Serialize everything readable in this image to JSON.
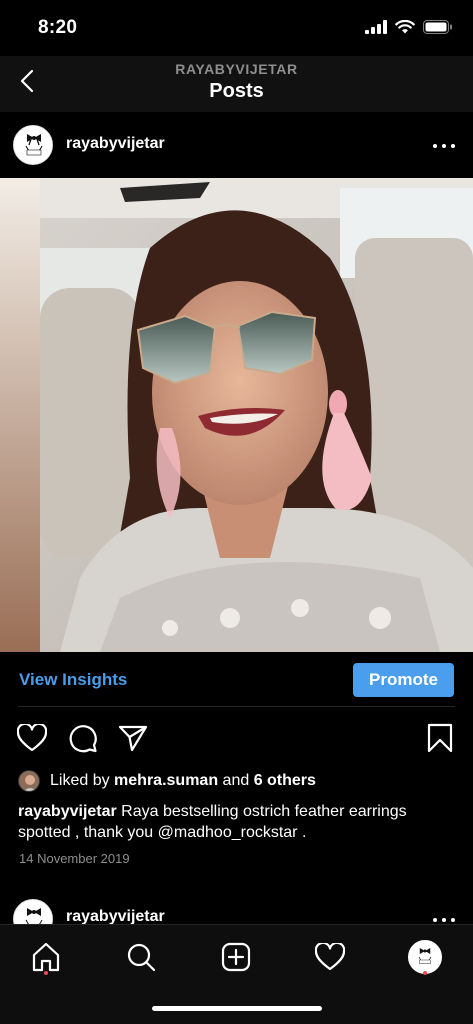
{
  "status_bar": {
    "time": "8:20"
  },
  "header": {
    "subtitle": "RAYABYVIJETAR",
    "title": "Posts"
  },
  "post": {
    "username": "rayabyvijetar",
    "insights_label": "View Insights",
    "promote_label": "Promote",
    "likes": {
      "prefix": "Liked by ",
      "liker": "mehra.suman",
      "conjunction": " and ",
      "others": "6 others"
    },
    "caption": {
      "username": "rayabyvijetar",
      "text": " Raya bestselling ostrich feather earrings spotted , thank you @madhoo_rockstar ."
    },
    "date": "14 November 2019"
  },
  "next_post": {
    "username": "rayabyvijetar"
  },
  "icons": {
    "back": "chevron-left-icon",
    "more": "more-horizontal-icon",
    "like": "heart-icon",
    "comment": "comment-icon",
    "share": "send-icon",
    "save": "bookmark-icon",
    "tabs": [
      "home-icon",
      "search-icon",
      "add-icon",
      "heart-icon",
      "profile-avatar"
    ]
  },
  "colors": {
    "accent": "#4b9eee",
    "link": "#4a9de8",
    "notification": "#ed4956",
    "background": "#000000"
  }
}
